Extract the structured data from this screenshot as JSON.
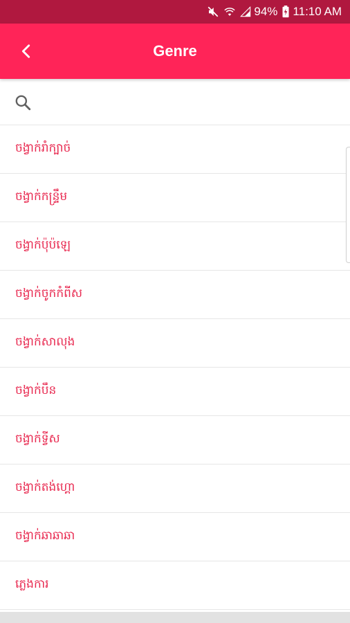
{
  "status_bar": {
    "battery": "94%",
    "time": "11:10 AM",
    "icons": [
      "mute-icon",
      "wifi-icon",
      "signal-icon",
      "battery-icon"
    ]
  },
  "app_bar": {
    "title": "Genre",
    "back_icon": "chevron-left-icon"
  },
  "search": {
    "icon": "search-icon",
    "value": "",
    "placeholder": ""
  },
  "genres": [
    "ចង្វាក់រាំក្បាច់",
    "ចង្វាក់កន្ទ្រឹម",
    "ចង្វាក់ប៉ុប៉ឡេ",
    "ចង្វាក់ចូកកំពីស",
    "ចង្វាក់សាលុង",
    "ចង្វាក់បឹន",
    "ចង្វាក់ទ្វីស",
    "ចង្វាក់តង់ហ្គោ",
    "ចង្វាក់ឆាឆាឆា",
    "ភ្លេងការ"
  ],
  "colors": {
    "status_bar": "#b0183f",
    "app_bar": "#ff2458",
    "item_text": "#e8284f",
    "divider": "#e6e6e6"
  }
}
